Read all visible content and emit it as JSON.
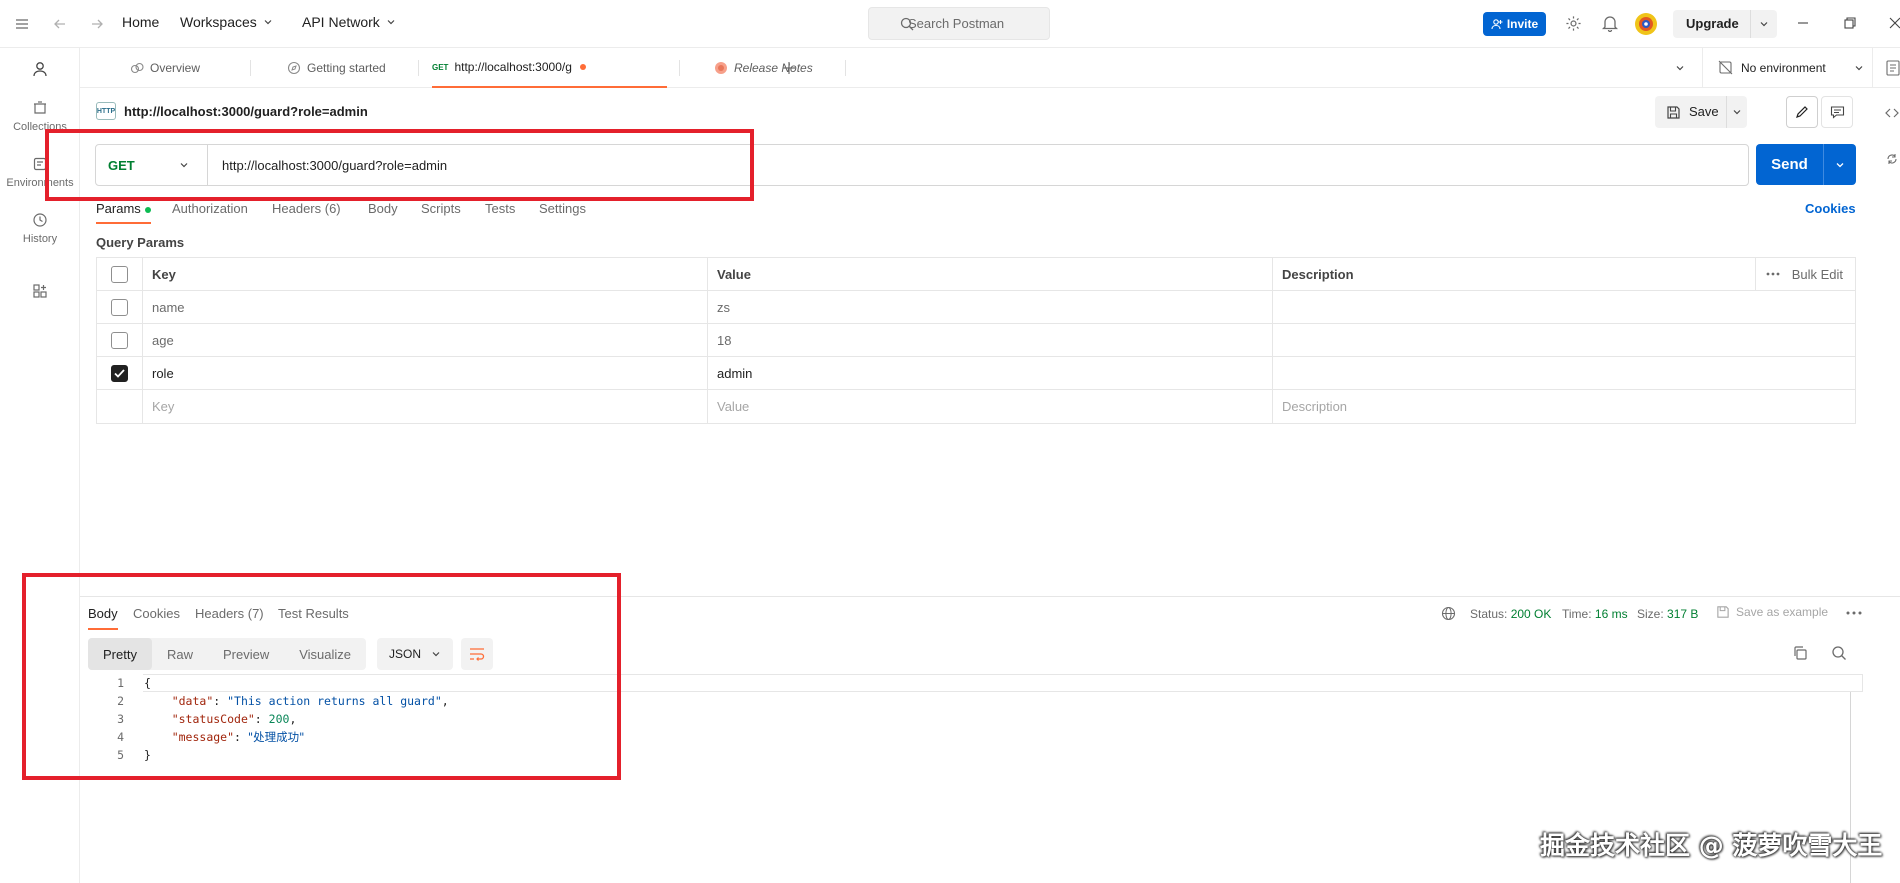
{
  "topbar": {
    "home": "Home",
    "workspaces": "Workspaces",
    "api_network": "API Network",
    "search_placeholder": "Search Postman",
    "invite": "Invite",
    "upgrade": "Upgrade"
  },
  "sidebar": {
    "items": [
      {
        "label": "Collections",
        "icon": "collections-icon"
      },
      {
        "label": "Environments",
        "icon": "environments-icon"
      },
      {
        "label": "History",
        "icon": "history-icon"
      }
    ]
  },
  "tabs": [
    {
      "label": "Overview"
    },
    {
      "label": "Getting started"
    },
    {
      "method": "GET",
      "label": "http://localhost:3000/g"
    },
    {
      "label": "Release Notes"
    }
  ],
  "environment": "No environment",
  "request": {
    "badge": "HTTP",
    "title": "http://localhost:3000/guard?role=admin",
    "save": "Save",
    "method": "GET",
    "url": "http://localhost:3000/guard?role=admin",
    "send": "Send",
    "tabs": [
      "Params",
      "Authorization",
      "Headers (6)",
      "Body",
      "Scripts",
      "Tests",
      "Settings"
    ],
    "cookies": "Cookies",
    "query_params_label": "Query Params",
    "columns": [
      "Key",
      "Value",
      "Description"
    ],
    "bulk_edit": "Bulk Edit",
    "params": [
      {
        "key": "name",
        "value": "zs",
        "checked": false
      },
      {
        "key": "age",
        "value": "18",
        "checked": false
      },
      {
        "key": "role",
        "value": "admin",
        "checked": true
      }
    ],
    "placeholder": {
      "key": "Key",
      "value": "Value",
      "description": "Description"
    }
  },
  "response": {
    "tabs": [
      "Body",
      "Cookies",
      "Headers (7)",
      "Test Results"
    ],
    "status_label": "Status:",
    "status": "200 OK",
    "time_label": "Time:",
    "time": "16 ms",
    "size_label": "Size:",
    "size": "317 B",
    "save_example": "Save as example",
    "views": [
      "Pretty",
      "Raw",
      "Preview",
      "Visualize"
    ],
    "format": "JSON",
    "line_numbers": [
      "1",
      "2",
      "3",
      "4",
      "5"
    ],
    "body": {
      "open": "{",
      "data_key": "\"data\"",
      "data_value": "\"This action returns all guard\"",
      "status_key": "\"statusCode\"",
      "status_value": "200",
      "message_key": "\"message\"",
      "message_value": "\"处理成功\"",
      "close": "}"
    }
  },
  "watermark": "掘金技术社区 @ 菠萝吹雪大王",
  "colors": {
    "accent": "#ff6c37",
    "primary": "#0265d2",
    "highlight": "#e4202b",
    "success": "#007f31"
  }
}
